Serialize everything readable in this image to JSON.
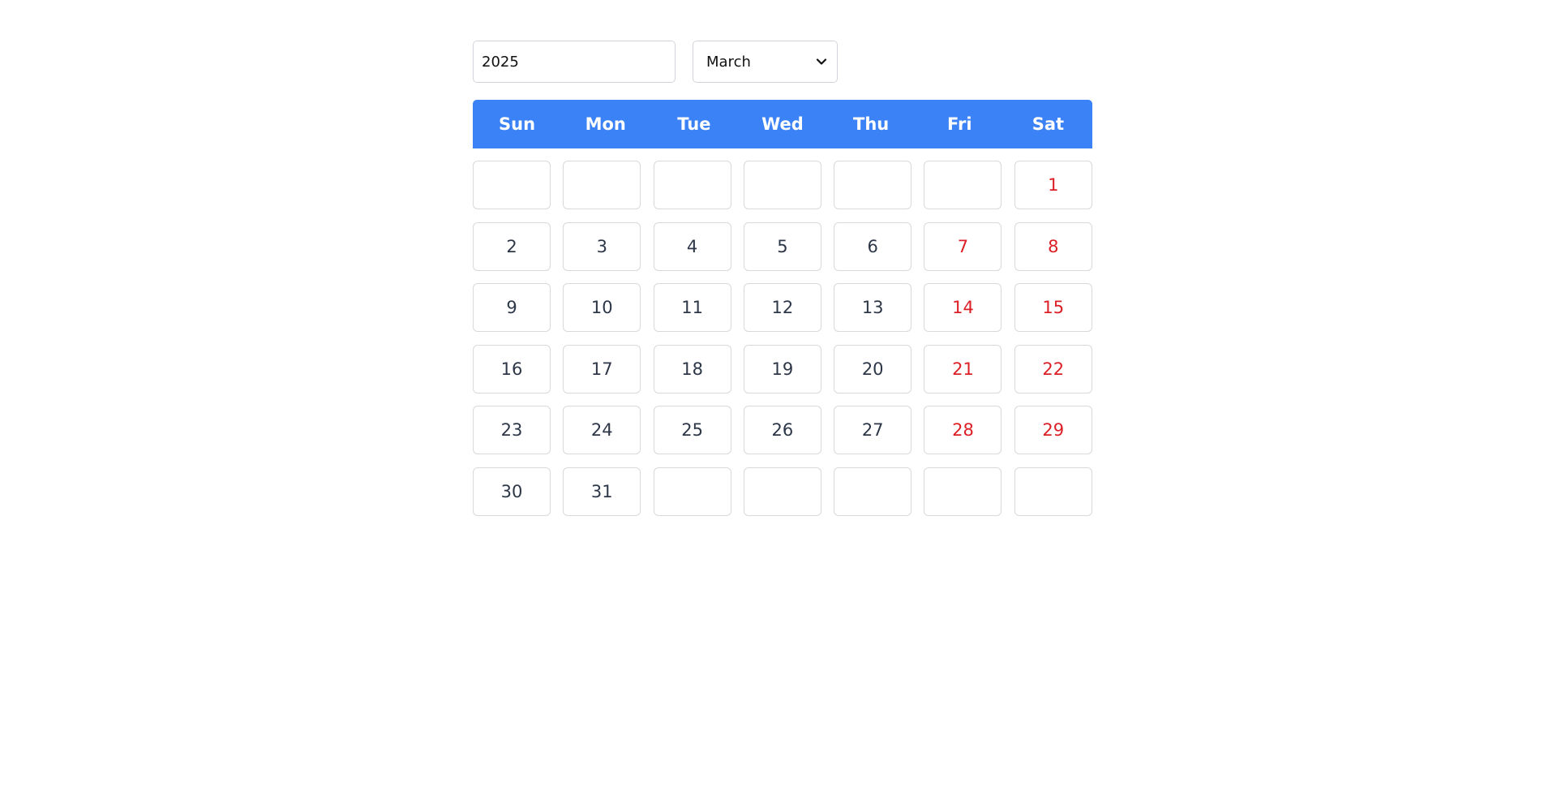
{
  "controls": {
    "year_value": "2025",
    "month_selected": "March"
  },
  "weekdays": [
    "Sun",
    "Mon",
    "Tue",
    "Wed",
    "Thu",
    "Fri",
    "Sat"
  ],
  "calendar": {
    "weeks": [
      [
        "",
        "",
        "",
        "",
        "",
        "",
        "1"
      ],
      [
        "2",
        "3",
        "4",
        "5",
        "6",
        "7",
        "8"
      ],
      [
        "9",
        "10",
        "11",
        "12",
        "13",
        "14",
        "15"
      ],
      [
        "16",
        "17",
        "18",
        "19",
        "20",
        "21",
        "22"
      ],
      [
        "23",
        "24",
        "25",
        "26",
        "27",
        "28",
        "29"
      ],
      [
        "30",
        "31",
        "",
        "",
        "",
        "",
        ""
      ]
    ],
    "highlighted_columns": [
      "Fri",
      "Sat"
    ]
  },
  "colors": {
    "header_background": "#3b82f6",
    "header_text": "#ffffff",
    "day_text": "#2d3748",
    "weekend_text": "#dc1f26",
    "cell_border": "#d7d9dd"
  },
  "icons": {
    "dropdown": "chevron-down-icon"
  }
}
